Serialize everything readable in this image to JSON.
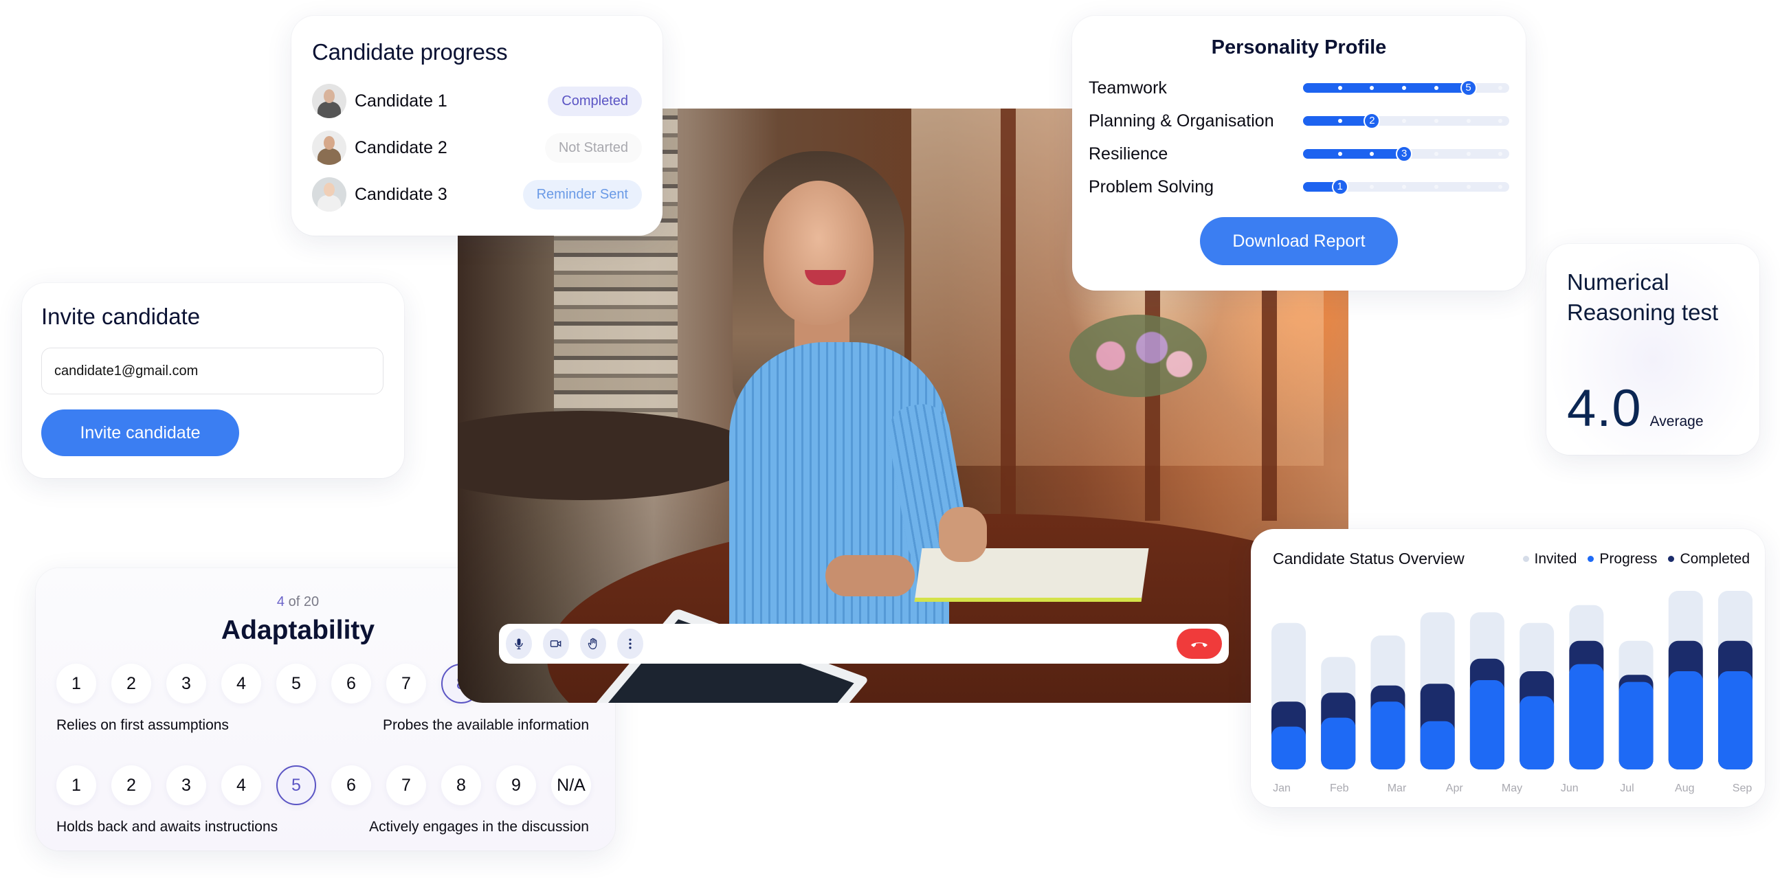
{
  "candidate_progress": {
    "title": "Candidate progress",
    "candidates": [
      {
        "name": "Candidate 1",
        "status": "Completed",
        "status_color": "#5b55c4",
        "status_bg": "#ebedfb",
        "avatar": {
          "bg": "#e4e4e4",
          "skin": "#d8b39b",
          "clothes": "#555555"
        }
      },
      {
        "name": "Candidate 2",
        "status": "Not Started",
        "status_color": "#a8a8ae",
        "status_bg": "#fafafa",
        "avatar": {
          "bg": "#ececec",
          "skin": "#d6a88a",
          "clothes": "#8a6e52"
        }
      },
      {
        "name": "Candidate 3",
        "status": "Reminder Sent",
        "status_color": "#6a9ae6",
        "status_bg": "#eaf1fd",
        "avatar": {
          "bg": "#d8dcde",
          "skin": "#f0cfb7",
          "clothes": "#f0f0f0"
        }
      }
    ]
  },
  "personality_profile": {
    "title": "Personality Profile",
    "scale_max": 6,
    "traits": [
      {
        "label": "Teamwork",
        "value": 5
      },
      {
        "label": "Planning & Organisation",
        "value": 2
      },
      {
        "label": "Resilience",
        "value": 3
      },
      {
        "label": "Problem Solving",
        "value": 1
      }
    ],
    "button_label": "Download Report"
  },
  "invite": {
    "title": "Invite candidate",
    "email_value": "candidate1@gmail.com",
    "button_label": "Invite candidate"
  },
  "numerical": {
    "title": "Numerical Reasoning test",
    "score": "4.0",
    "score_label": "Average"
  },
  "adaptability": {
    "counter_current": "4",
    "counter_rest": " of 20",
    "title": "Adaptability",
    "rows": [
      {
        "options": [
          "1",
          "2",
          "3",
          "4",
          "5",
          "6",
          "7",
          "8"
        ],
        "selected": "8",
        "left_anchor": "Relies on first assumptions",
        "right_anchor": "Probes the available information"
      },
      {
        "options": [
          "1",
          "2",
          "3",
          "4",
          "5",
          "6",
          "7",
          "8",
          "9",
          "N/A"
        ],
        "selected": "5",
        "left_anchor": "Holds back and awaits instructions",
        "right_anchor": "Actively engages in the discussion"
      }
    ]
  },
  "call_controls": {
    "buttons": [
      "microphone",
      "camera",
      "raise-hand",
      "more-options"
    ],
    "hangup": "end-call",
    "hangup_color": "#f03b3b"
  },
  "chart_data": {
    "type": "bar",
    "title": "Candidate Status Overview",
    "xlabel": "",
    "ylabel": "",
    "ylim": [
      0,
      100
    ],
    "grid": false,
    "legend_position": "top-right",
    "categories": [
      "Jan",
      "Feb",
      "Mar",
      "Apr",
      "May",
      "Jun",
      "Jul",
      "Aug",
      "Sep"
    ],
    "bar_count": 10,
    "series": [
      {
        "name": "Invited",
        "color": "#e5ebf5",
        "values": [
          82,
          63,
          75,
          88,
          88,
          82,
          92,
          72,
          100,
          100
        ]
      },
      {
        "name": "Completed",
        "color": "#1b2c6b",
        "values": [
          38,
          43,
          47,
          48,
          62,
          55,
          72,
          53,
          72,
          72
        ]
      },
      {
        "name": "Progress",
        "color": "#1e6af5",
        "values": [
          24,
          29,
          38,
          27,
          50,
          41,
          59,
          49,
          55,
          55
        ]
      }
    ],
    "legend": [
      {
        "name": "Invited",
        "color": "#d5dce8"
      },
      {
        "name": "Progress",
        "color": "#1e6af5"
      },
      {
        "name": "Completed",
        "color": "#1b2c6b"
      }
    ]
  }
}
